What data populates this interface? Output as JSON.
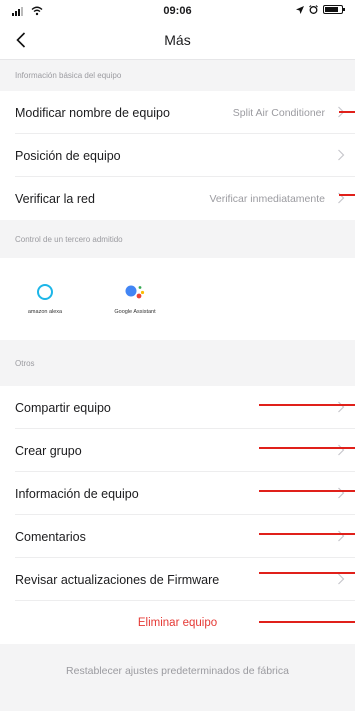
{
  "status_bar": {
    "time": "09:06"
  },
  "nav": {
    "title": "Más"
  },
  "sections": {
    "basic": {
      "header": "Información básica del equipo",
      "rows": [
        {
          "label": "Modificar nombre de equipo",
          "value": "Split Air Conditioner"
        },
        {
          "label": "Posición de equipo",
          "value": ""
        },
        {
          "label": "Verificar la red",
          "value": "Verificar inmediatamente"
        }
      ]
    },
    "third_party": {
      "header": "Control de un tercero admitido",
      "items": [
        {
          "label": "amazon alexa",
          "icon": "alexa-icon"
        },
        {
          "label": "Google Assistant",
          "icon": "google-assistant-icon"
        }
      ]
    },
    "others": {
      "header": "Otros",
      "rows": [
        {
          "label": "Compartir equipo"
        },
        {
          "label": "Crear grupo"
        },
        {
          "label": "Información de equipo"
        },
        {
          "label": "Comentarios"
        },
        {
          "label": "Revisar actualizaciones de Firmware"
        }
      ]
    }
  },
  "actions": {
    "delete": "Eliminar equipo",
    "reset": "Restablecer ajustes predeterminados de fábrica"
  },
  "colors": {
    "annotation_red": "#e0201a",
    "delete_text": "#e53935",
    "secondary_text": "#9b9ba0",
    "alexa_blue": "#1db6e8"
  }
}
